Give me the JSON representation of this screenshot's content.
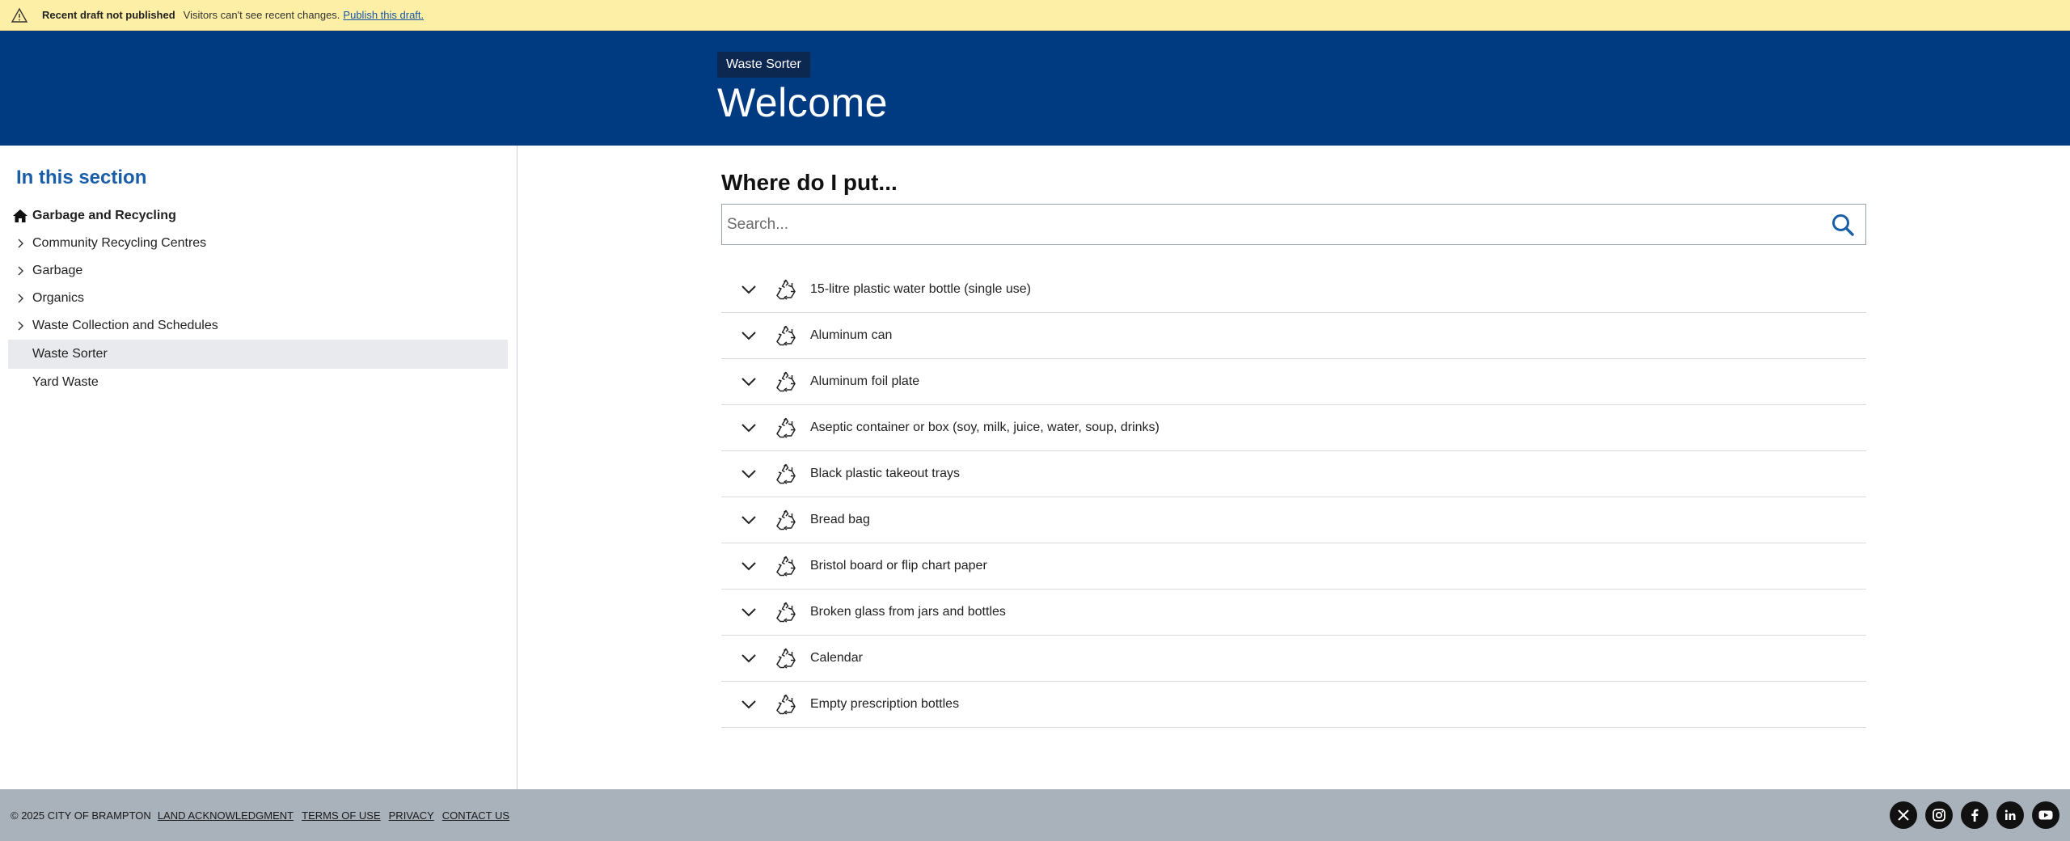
{
  "draft_banner": {
    "title": "Recent draft not published",
    "message": "Visitors can't see recent changes.",
    "link": "Publish this draft."
  },
  "header": {
    "breadcrumb_chip": "Waste Sorter",
    "title": "Welcome"
  },
  "sidebar": {
    "heading": "In this section",
    "items": [
      {
        "label": "Garbage and Recycling",
        "icon": "home-icon"
      },
      {
        "label": "Community Recycling Centres",
        "icon": "chevron-right-icon"
      },
      {
        "label": "Garbage",
        "icon": "chevron-right-icon"
      },
      {
        "label": "Organics",
        "icon": "chevron-right-icon"
      },
      {
        "label": "Waste Collection and Schedules",
        "icon": "chevron-right-icon"
      },
      {
        "label": "Waste Sorter",
        "active": true
      },
      {
        "label": "Yard Waste"
      }
    ]
  },
  "main": {
    "heading": "Where do I put...",
    "search_placeholder": "Search...",
    "items": [
      "15-litre plastic water bottle (single use)",
      "Aluminum can",
      "Aluminum foil plate",
      "Aseptic container or box (soy, milk, juice, water, soup, drinks)",
      "Black plastic takeout trays",
      "Bread bag",
      "Bristol board or flip chart paper",
      "Broken glass from jars and bottles",
      "Calendar",
      "Empty prescription bottles"
    ]
  },
  "footer": {
    "copyright": "© 2025 CITY OF BRAMPTON",
    "links": [
      "LAND ACKNOWLEDGMENT",
      "TERMS OF USE",
      "PRIVACY",
      "CONTACT US"
    ],
    "socials": [
      "x-icon",
      "instagram-icon",
      "facebook-icon",
      "linkedin-icon",
      "youtube-icon"
    ]
  },
  "colors": {
    "header_bg": "#003a80",
    "banner_bg": "#fdf0a6",
    "footer_bg": "#a9b1bb",
    "accent": "#1a5ea8"
  }
}
